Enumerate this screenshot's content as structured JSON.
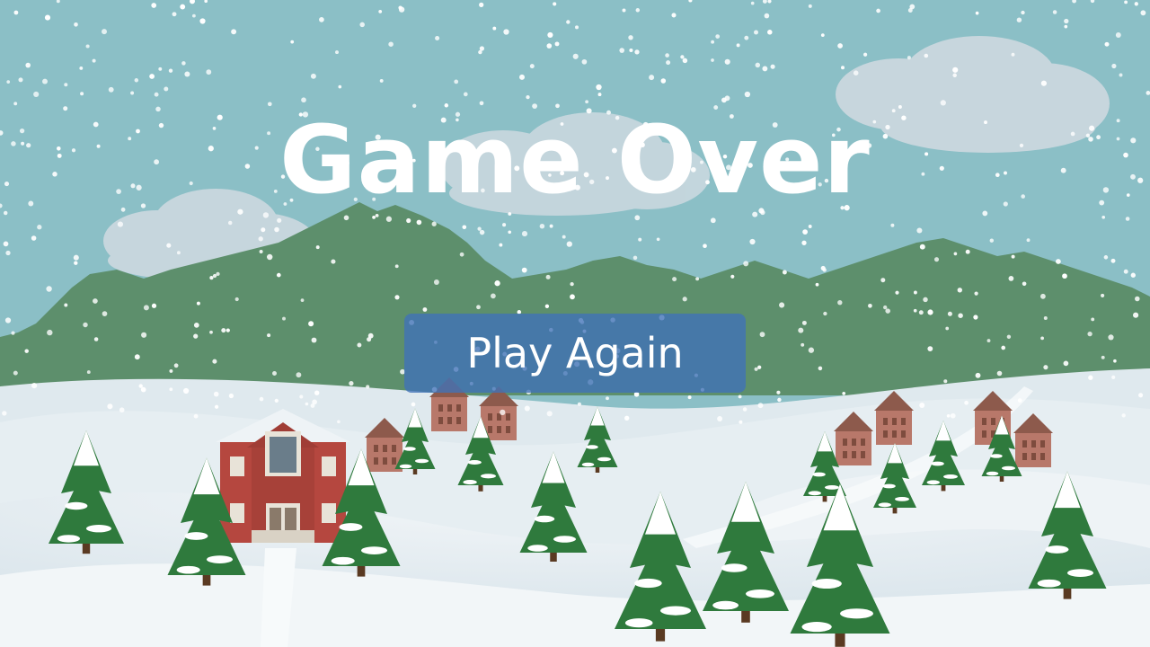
{
  "screen": {
    "title": "Game Over",
    "play_again_label": "Play Again"
  },
  "colors": {
    "sky": "#8bbfc6",
    "forest": "#5d8f6c",
    "snow": "#eef3f6",
    "button": "#4072b8",
    "house_red": "#b5473f",
    "tree_green": "#2f7a3d"
  },
  "icons": [
    "cloud-icon",
    "snowflake-icon",
    "pine-tree-icon",
    "house-icon"
  ]
}
